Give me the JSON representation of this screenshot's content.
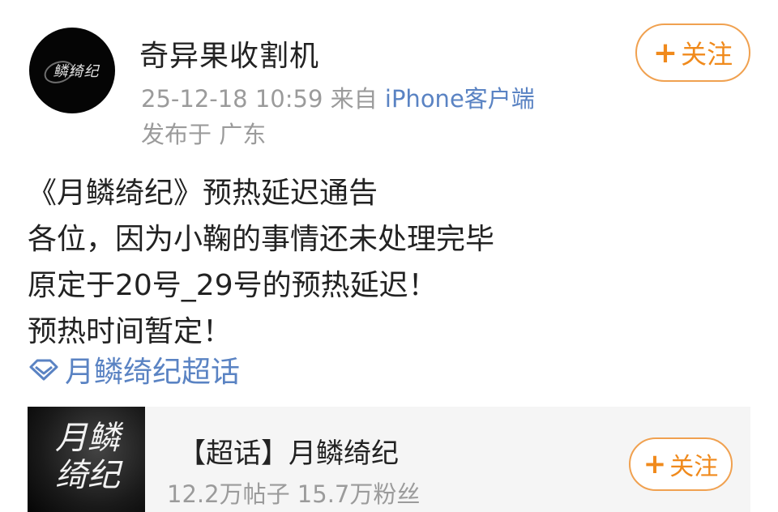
{
  "author": {
    "name": "奇异果收割机",
    "avatar_logo": "鳞绮纪",
    "timestamp": "25-12-18 10:59",
    "source_prefix": "来自",
    "client": "iPhone客户端",
    "location": "发布于 广东"
  },
  "follow_button": {
    "plus": "+",
    "label": "关注"
  },
  "post": {
    "lines": [
      "《月鳞绮纪》预热延迟通告",
      "各位，因为小鞠的事情还未处理完毕",
      "原定于20号_29号的预热延迟！",
      "预热时间暂定！"
    ],
    "topic_link": "月鳞绮纪超话"
  },
  "topic_card": {
    "thumb_text": "月鳞绮纪",
    "title": "【超话】月鳞绮纪",
    "stats": "12.2万帖子 15.7万粉丝",
    "follow_plus": "+",
    "follow_label": "关注"
  },
  "colors": {
    "accent": "#f08a1c",
    "link": "#5a83c3",
    "meta": "#9b9b9b"
  }
}
